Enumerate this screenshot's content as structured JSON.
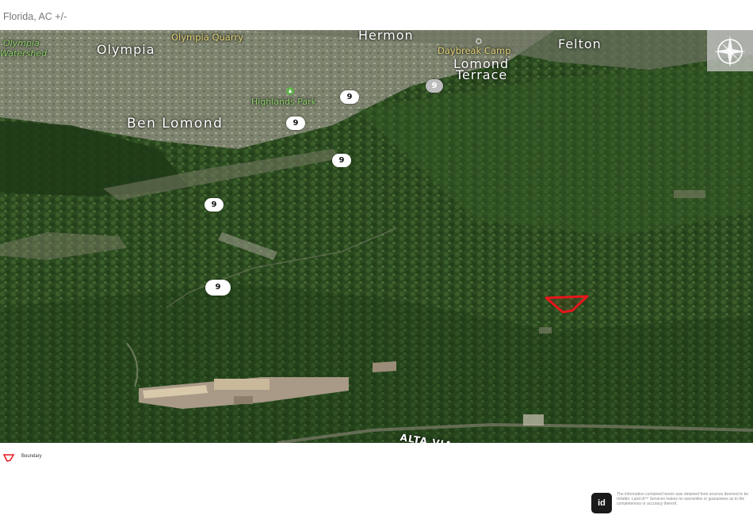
{
  "header": {
    "title": "Florida,  AC +/-"
  },
  "map": {
    "labels": {
      "hermon": "Hermon",
      "felton": "Felton",
      "olympia": "Olympia",
      "olympia_watershed_1": "Olympia",
      "olympia_watershed_2": "Watershed",
      "olympia_quarry": "Olympia Quarry",
      "daybreak_camp": "Daybreak Camp",
      "lomond_terrace_1": "Lomond",
      "lomond_terrace_2": "Terrace",
      "highlands_park": "Highlands Park",
      "ben_lomond": "Ben Lomond",
      "alta_via_dr": "ALTA VIA DR"
    },
    "route_shields": [
      "9",
      "9",
      "9",
      "9",
      "9",
      "9"
    ],
    "boundary_color": "#e8151b",
    "icons": [
      "compass-icon",
      "park-icon",
      "route-9-shield-icon"
    ]
  },
  "legend": {
    "label": "Boundary",
    "icon": "boundary-icon"
  },
  "footer": {
    "logo_text": "id",
    "disclaimer": "The information contained herein was obtained from sources deemed to be reliable. Land id™ Services makes no warranties or guarantees as to the completeness or accuracy thereof."
  }
}
